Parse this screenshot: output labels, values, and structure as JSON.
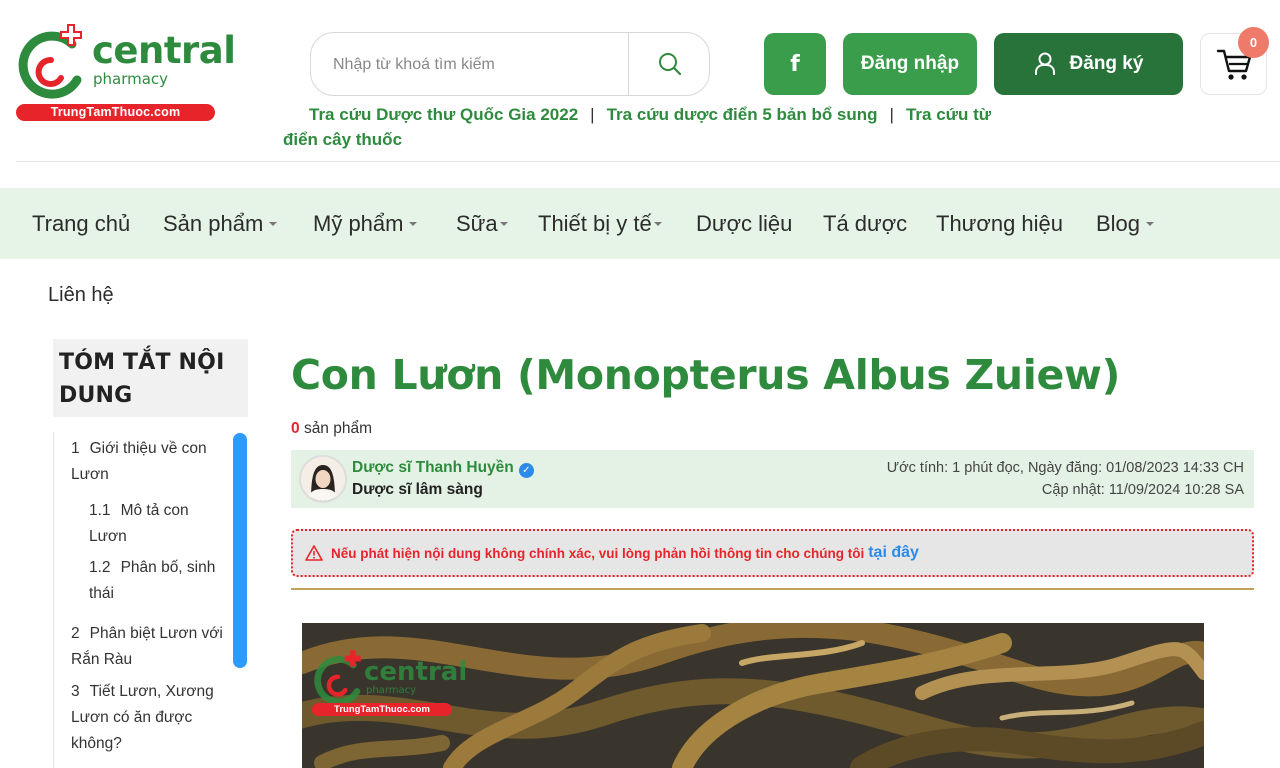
{
  "brand": {
    "name": "central",
    "sub": "pharmacy",
    "banner": "TrungTamThuoc.com"
  },
  "search": {
    "placeholder": "Nhập từ khoá tìm kiếm"
  },
  "header": {
    "facebook_label": "f",
    "login_label": "Đăng nhập",
    "register_label": "Đăng ký",
    "cart_count": "0"
  },
  "quick_links": [
    "Tra cứu Dược thư Quốc Gia 2022",
    "Tra cứu dược điển 5 bản bổ sung",
    "Tra cứu từ điển cây thuốc"
  ],
  "quick_links_sep": "|",
  "nav": {
    "items": [
      {
        "label": "Trang chủ"
      },
      {
        "label": "Sản phẩm"
      },
      {
        "label": "Mỹ phẩm"
      },
      {
        "label": "Sữa"
      },
      {
        "label": "Thiết bị y tế"
      },
      {
        "label": "Dược liệu"
      },
      {
        "label": "Tá dược"
      },
      {
        "label": "Thương hiệu"
      },
      {
        "label": "Blog"
      }
    ],
    "contact": "Liên hệ"
  },
  "toc": {
    "title": "TÓM TẮT NỘI DUNG",
    "items": [
      {
        "num": "1",
        "text": "Giới thiệu về con Lươn"
      },
      {
        "num": "1.1",
        "text": "Mô tả con Lươn"
      },
      {
        "num": "1.2",
        "text": "Phân bố, sinh thái"
      },
      {
        "num": "2",
        "text": "Phân biệt Lươn với Rắn Ràu"
      },
      {
        "num": "3",
        "text": "Tiết Lươn, Xương Lươn có ăn được không?"
      }
    ]
  },
  "article": {
    "title": "Con Lươn (Monopterus Albus Zuiew)",
    "product_count": "0",
    "product_label": "sản phẩm",
    "author_name": "Dược sĩ Thanh Huyền",
    "author_role": "Dược sĩ lâm sàng",
    "meta_line1": "Ước tính: 1 phút đọc, Ngày đăng: 01/08/2023 14:33 CH",
    "meta_line2": "Cập nhật: 11/09/2024 10:28 SA",
    "warning_text": "Nếu phát hiện nội dung không chính xác, vui lòng phản hồi thông tin cho chúng tôi",
    "warning_link": "tại đây"
  },
  "icons": {
    "search": "search-icon",
    "user": "user-icon",
    "cart": "cart-icon",
    "warning": "warning-icon",
    "verified": "verified-icon"
  },
  "colors": {
    "brand_green": "#2e8b3e",
    "button_green": "#3a9d4b",
    "dark_green": "#27733a",
    "brand_red": "#e8242b",
    "nav_bg": "#e5f4e7",
    "link_blue": "#2c8be8"
  }
}
